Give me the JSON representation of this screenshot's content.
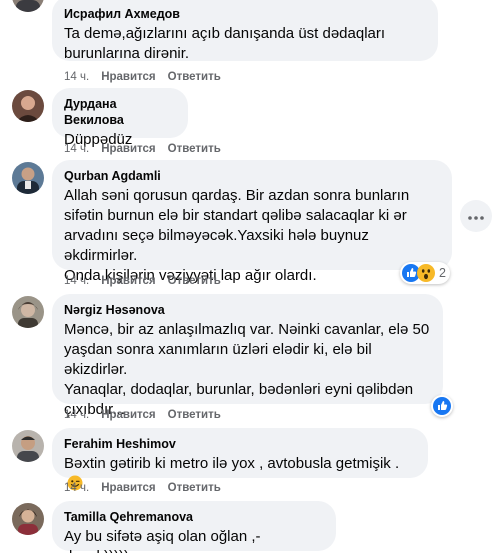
{
  "actions": {
    "time": "14 ч.",
    "like": "Нравится",
    "reply": "Ответить"
  },
  "comments": [
    {
      "author": "Исрафил Ахмедов",
      "text": "Ta demə,ağızlarını açıb danışanda üst dədaqları\nburunlarına dirənir."
    },
    {
      "author": "Дурдана Векилова",
      "text": "Düppədüz"
    },
    {
      "author": "Qurban Agdamli",
      "text": "Allah səni qorusun qardaş. Bir azdan sonra bunların\nsifətin burnun elə bir standart qəlibə salacaqlar ki ər\narvadını seçə bilməyəcək.Yaxsiki hələ buynuz əkdirmirlər.\nOnda kişilərin vəziyyəti lap ağır olardı.",
      "reaction_count": "2"
    },
    {
      "author": "Nərgiz Həsənova",
      "text": "Məncə, bir az anlaşılmazlıq var. Nəinki cavanlar, elə 50\nyaşdan sonra xanımların üzləri elədir ki, elə bil əkizdirlər.\nYanaqlar, dodaqlar, burunlar, bədənləri eyni qəlibdən\nçıxıbdır..."
    },
    {
      "author": "Ferahim Heshimov",
      "text": "Bəxtin gətirib ki metro ilə yox , avtobusla getmişik ."
    },
    {
      "author": "Tamilla Qehremanova",
      "text": "Ay bu sifətə aşiq olan oğlan ,- deyək)))))"
    }
  ],
  "colors": {
    "bubble": "#f0f2f5",
    "meta": "#65676b",
    "like_blue": "#1877f2",
    "wow_yellow": "#f7b928"
  },
  "icons": [
    "more-horizontal-icon",
    "like-reaction-icon",
    "wow-reaction-icon",
    "wink-emoji-icon"
  ]
}
